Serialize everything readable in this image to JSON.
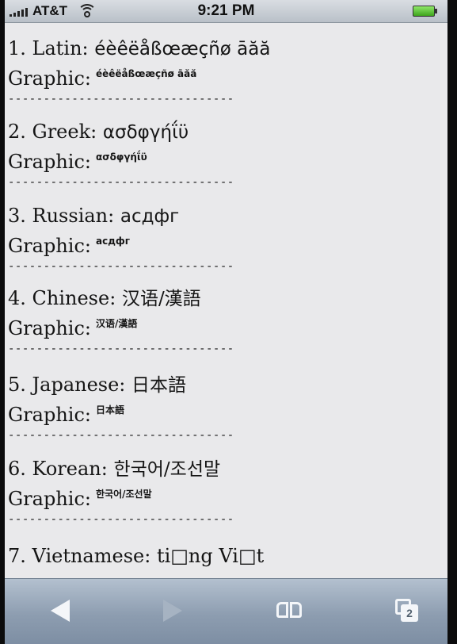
{
  "status_bar": {
    "carrier": "AT&T",
    "time": "9:21 PM"
  },
  "entries": [
    {
      "label": "1. Latin:",
      "native": "éèêëåßœæçñø āăă",
      "graphic_label": "Graphic:",
      "graphic_sample": "éèêëåßœæçñø āăă"
    },
    {
      "label": "2. Greek:",
      "native": "ασδφγήΐϋ",
      "graphic_label": "Graphic:",
      "graphic_sample": "ασδφγήΐϋ"
    },
    {
      "label": "3. Russian:",
      "native": "асдфг",
      "graphic_label": "Graphic:",
      "graphic_sample": "асдфг"
    },
    {
      "label": "4. Chinese:",
      "native": "汉语/漢語",
      "graphic_label": "Graphic:",
      "graphic_sample": "汉语/漢語"
    },
    {
      "label": "5. Japanese:",
      "native": "日本語",
      "graphic_label": "Graphic:",
      "graphic_sample": "日本語"
    },
    {
      "label": "6. Korean:",
      "native": "한국어/조선말",
      "graphic_label": "Graphic:",
      "graphic_sample": "한국어/조선말"
    },
    {
      "label": "7. Vietnamese:",
      "native": "ti□ng Vi□t"
    }
  ],
  "separator": "--------------------------------",
  "toolbar": {
    "back_icon": "back-arrow-icon",
    "forward_icon": "forward-arrow-icon",
    "bookmarks_icon": "bookmarks-icon",
    "pages_icon": "pages-icon",
    "pages_count": "2"
  }
}
